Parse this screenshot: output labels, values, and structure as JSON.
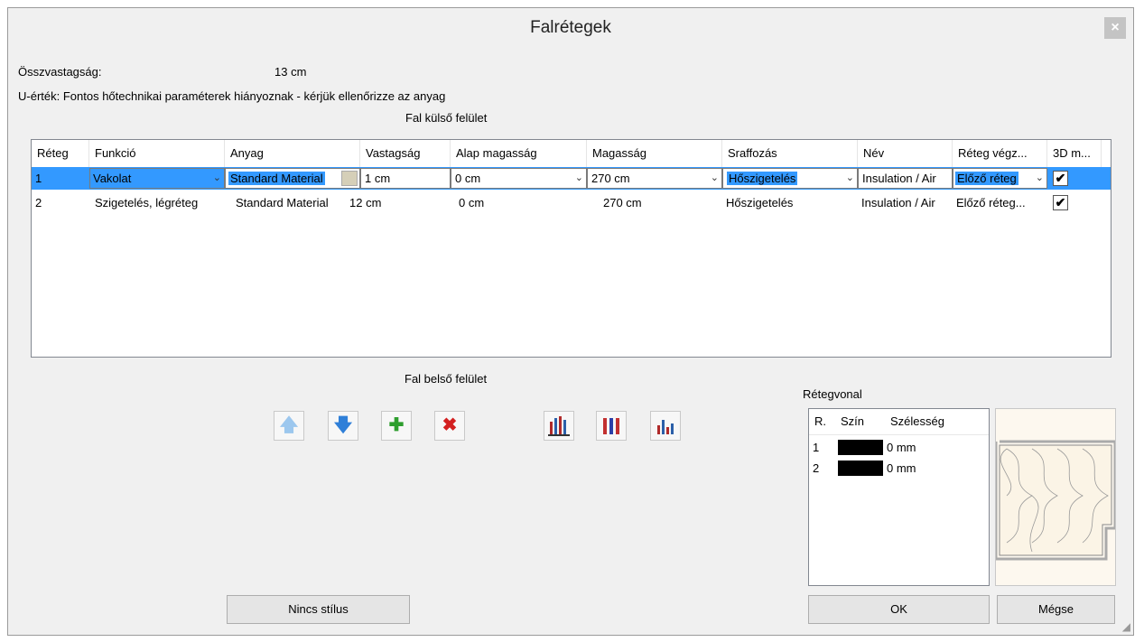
{
  "window": {
    "title": "Falrétegek",
    "close_label": "×"
  },
  "summary": {
    "thickness_label": "Összvastagság:",
    "thickness_value": "13 cm",
    "uvalue_text": "U-érték: Fontos hőtechnikai paraméterek hiányoznak - kérjük ellenőrizze az anyag"
  },
  "outer_label": "Fal külső felület",
  "inner_label": "Fal belső felület",
  "layers_table": {
    "columns": [
      "Réteg",
      "Funkció",
      "Anyag",
      "Vastagság",
      "Alap magasság",
      "Magasság",
      "Sraffozás",
      "Név",
      "Réteg végz...",
      "3D m..."
    ],
    "rows": [
      {
        "layer": "1",
        "function": "Vakolat",
        "material": "Standard Material",
        "thickness": "1 cm",
        "base_height": "0 cm",
        "height": "270 cm",
        "hatch": "Hőszigetelés",
        "name": "Insulation / Air",
        "end": "Előző réteg",
        "model3d": "✔",
        "selected": true
      },
      {
        "layer": "2",
        "function": "Szigetelés, légréteg",
        "material": "Standard Material",
        "thickness": "12 cm",
        "base_height": "0 cm",
        "height": "270 cm",
        "hatch": "Hőszigetelés",
        "name": "Insulation / Air",
        "end": "Előző réteg...",
        "model3d": "✔",
        "selected": false
      }
    ]
  },
  "toolbar": {
    "move_up_icon": "arrow-up-icon",
    "move_down_icon": "arrow-down-icon",
    "add_icon": "plus-icon",
    "delete_icon": "x-icon",
    "up_glyph": "🡅",
    "down_glyph": "🡇",
    "add_glyph": "✚",
    "delete_glyph": "✖"
  },
  "layer_lines": {
    "title": "Rétegvonal",
    "columns": [
      "R.",
      "Szín",
      "Szélesség"
    ],
    "rows": [
      {
        "r": "1",
        "color": "#000000",
        "width": "0 mm"
      },
      {
        "r": "2",
        "color": "#000000",
        "width": "0 mm"
      }
    ]
  },
  "buttons": {
    "no_style": "Nincs stílus",
    "ok": "OK",
    "cancel": "Mégse"
  },
  "colors": {
    "selection": "#3399ff",
    "add_green": "#2e9e2e",
    "delete_red": "#d32020",
    "arrow_blue": "#2f7fd8"
  }
}
